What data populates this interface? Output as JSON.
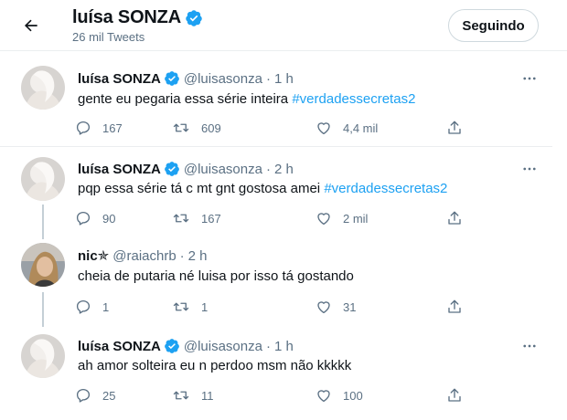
{
  "header": {
    "title": "luísa SONZA",
    "subtitle": "26 mil Tweets",
    "follow_label": "Seguindo"
  },
  "tweets": [
    {
      "name": "luísa SONZA",
      "handle": "@luisasonza",
      "dot": "·",
      "time": "1 h",
      "text": "gente eu pegaria essa série inteira ",
      "hashtag": "#verdadessecretas2",
      "replies": "167",
      "retweets": "609",
      "likes": "4,4 mil"
    },
    {
      "name": "luísa SONZA",
      "handle": "@luisasonza",
      "dot": "·",
      "time": "2 h",
      "text": "pqp essa série tá c mt gnt gostosa amei ",
      "hashtag": "#verdadessecretas2",
      "replies": "90",
      "retweets": "167",
      "likes": "2 mil"
    },
    {
      "name": "nic✯",
      "handle": "@raiachrb",
      "dot": "·",
      "time": "2 h",
      "text": "cheia de putaria né luisa por isso tá gostando",
      "hashtag": "",
      "replies": "1",
      "retweets": "1",
      "likes": "31"
    },
    {
      "name": "luísa SONZA",
      "handle": "@luisasonza",
      "dot": "·",
      "time": "1 h",
      "text": "ah amor solteira eu n perdoo msm não kkkkk",
      "hashtag": "",
      "replies": "25",
      "retweets": "11",
      "likes": "100"
    }
  ],
  "colors": {
    "accent": "#1da1f2",
    "text": "#0f1419",
    "muted": "#5b7083",
    "divider": "#ebeef0"
  },
  "icons": [
    "back-arrow-icon",
    "verified-badge-icon",
    "more-icon",
    "reply-icon",
    "retweet-icon",
    "like-icon",
    "share-icon"
  ]
}
